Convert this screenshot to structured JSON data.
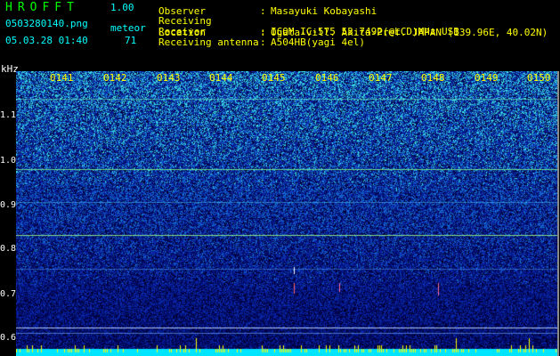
{
  "header": {
    "brand": "HROFFT",
    "version": "1.00",
    "filename": "0503280140.png",
    "datetime": "05.03.28 01:40",
    "meteor_label": "meteor",
    "meteor_count": "71"
  },
  "station_info": [
    {
      "key": "Observer",
      "value": "Masayuki Kobayashi"
    },
    {
      "key": "Receiving Location",
      "value": "Ogata-vill. Akita-Pref. JAPAN (139.96E, 40.02N)"
    },
    {
      "key": "Receiver",
      "value": "ICOM IC-575 53.7492(@LCD)MHz USB"
    },
    {
      "key": "Receiving antenna",
      "value": "A504HB(yagi 4el)"
    }
  ],
  "axis": {
    "y_unit": "kHz",
    "y_ticks": [
      "1.1",
      "1.0",
      "0.9",
      "0.8",
      "0.7",
      "0.6"
    ],
    "x_ticks": [
      "0141",
      "0142",
      "0143",
      "0144",
      "0145",
      "0146",
      "0147",
      "0148",
      "0149",
      "0150"
    ]
  },
  "colors": {
    "text_green": "#00ff00",
    "text_yellow": "#ffff00",
    "text_cyan": "#00ffff",
    "background": "#000000"
  }
}
